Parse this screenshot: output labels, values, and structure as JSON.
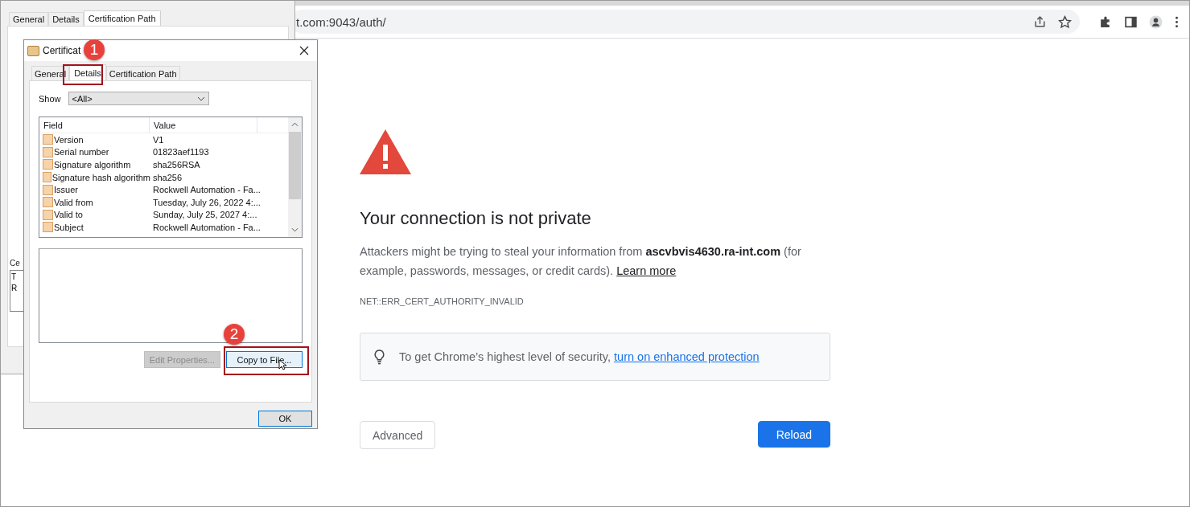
{
  "browser": {
    "address": "t.com:9043/auth/"
  },
  "interstitial": {
    "heading": "Your connection is not private",
    "body": "Attackers might be trying to steal your information from **ascvbvis4630.ra-int.com** (for example, passwords, messages, or credit cards).",
    "body_link": "Learn more",
    "error_code": "NET::ERR_CERT_AUTHORITY_INVALID",
    "tip": "To get Chrome’s highest level of security, ",
    "tip_link": "turn on enhanced protection",
    "buttons": [
      {
        "label": "Advanced",
        "kind": "secondary"
      },
      {
        "label": "Reload",
        "kind": "primary"
      }
    ]
  },
  "back_dialog": {
    "tabs": [
      {
        "label": "General",
        "selected": false
      },
      {
        "label": "Details",
        "selected": false
      },
      {
        "label": "Certification Path",
        "selected": true
      }
    ],
    "section_label": "Ce",
    "list_lines": [
      "T",
      "R"
    ]
  },
  "dialog": {
    "title": "Certificat",
    "tabs": [
      {
        "label": "General",
        "selected": false
      },
      {
        "label": "Details",
        "selected": true
      },
      {
        "label": "Certification Path",
        "selected": false
      }
    ],
    "show_label": "Show",
    "show_value": "<All>",
    "columns": [
      "Field",
      "Value"
    ],
    "rows": [
      {
        "field": "Version",
        "value": "V1"
      },
      {
        "field": "Serial number",
        "value": "01823aef1193"
      },
      {
        "field": "Signature algorithm",
        "value": "sha256RSA"
      },
      {
        "field": "Signature hash algorithm",
        "value": "sha256"
      },
      {
        "field": "Issuer",
        "value": "Rockwell Automation - Fa..."
      },
      {
        "field": "Valid from",
        "value": "Tuesday, July 26, 2022 4:..."
      },
      {
        "field": "Valid to",
        "value": "Sunday, July 25, 2027 4:..."
      },
      {
        "field": "Subject",
        "value": "Rockwell Automation - Fa..."
      }
    ],
    "buttons": [
      {
        "label": "Edit Properties...",
        "disabled": true
      },
      {
        "label": "Copy to File...",
        "disabled": false
      }
    ],
    "ok": "OK"
  },
  "annotations": [
    {
      "number": "1"
    },
    {
      "number": "2"
    }
  ]
}
